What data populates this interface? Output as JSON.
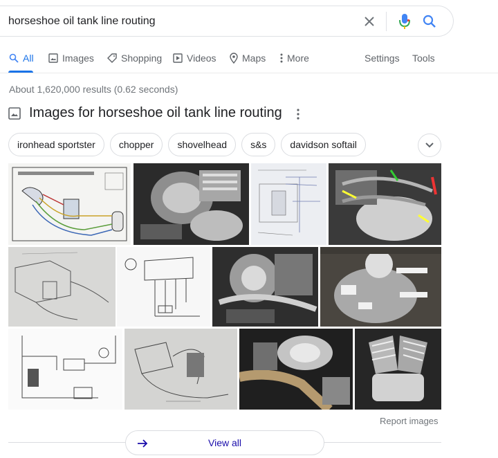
{
  "search": {
    "query": "horseshoe oil tank line routing"
  },
  "tabs": [
    {
      "label": "All",
      "icon": "search-icon"
    },
    {
      "label": "Images",
      "icon": "image-icon"
    },
    {
      "label": "Shopping",
      "icon": "tag-icon"
    },
    {
      "label": "Videos",
      "icon": "play-icon"
    },
    {
      "label": "Maps",
      "icon": "map-pin-icon"
    },
    {
      "label": "More",
      "icon": "dots-vertical-icon"
    },
    {
      "label": "Settings"
    },
    {
      "label": "Tools"
    }
  ],
  "result_stats": "About 1,620,000 results (0.62 seconds)",
  "images_section": {
    "title": "Images for horseshoe oil tank line routing",
    "chips": [
      "ironhead sportster",
      "chopper",
      "shovelhead",
      "s&s",
      "davidson softail"
    ],
    "report_label": "Report images",
    "view_all_label": "View all"
  },
  "colors": {
    "accent": "#1a73e8",
    "link": "#1a0dab",
    "muted": "#70757a",
    "border": "#dadce0"
  }
}
